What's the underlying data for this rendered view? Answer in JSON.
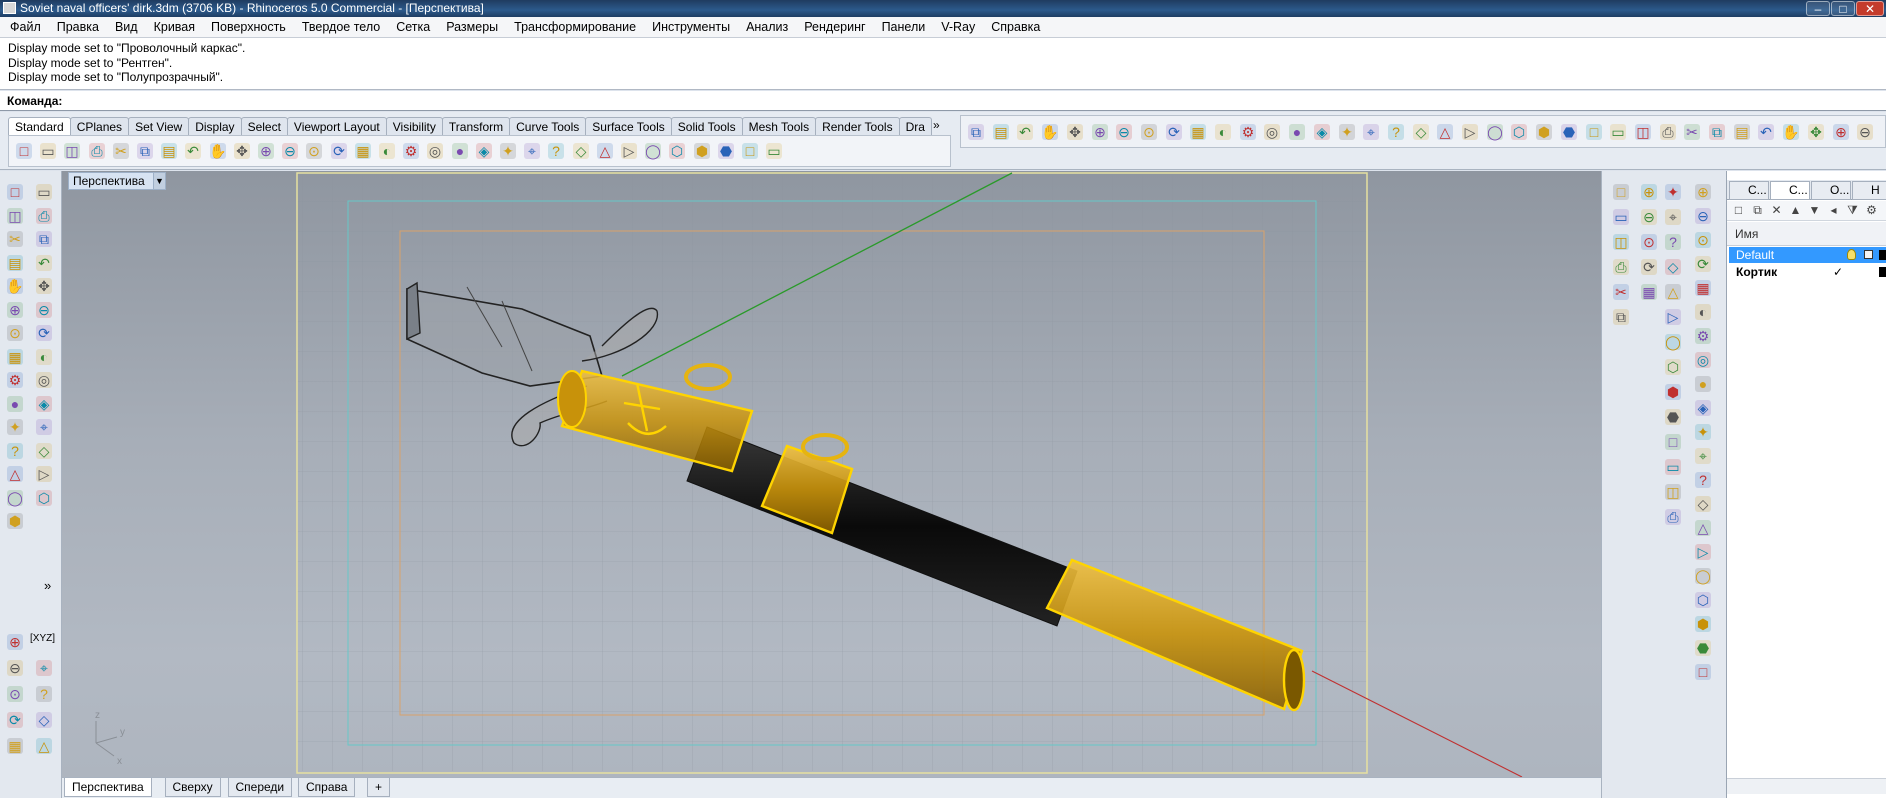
{
  "window": {
    "title": "Soviet naval officers' dirk.3dm (3706 KB) - Rhinoceros 5.0 Commercial - [Перспектива]",
    "minimize": "–",
    "maximize": "□",
    "close": "✕"
  },
  "menu": [
    "Файл",
    "Правка",
    "Вид",
    "Кривая",
    "Поверхность",
    "Твердое тело",
    "Сетка",
    "Размеры",
    "Трансформирование",
    "Инструменты",
    "Анализ",
    "Рендеринг",
    "Панели",
    "V-Ray",
    "Справка"
  ],
  "history": [
    "Display mode set to \"Проволочный каркас\".",
    "Display mode set to \"Рентген\".",
    "Display mode set to \"Полупрозрачный\"."
  ],
  "command": {
    "label": "Команда:"
  },
  "toolbar_tabs": [
    "Standard",
    "CPlanes",
    "Set View",
    "Display",
    "Select",
    "Viewport Layout",
    "Visibility",
    "Transform",
    "Curve Tools",
    "Surface Tools",
    "Solid Tools",
    "Mesh Tools",
    "Render Tools",
    "Dra"
  ],
  "tabs_more": "»",
  "viewport": {
    "title": "Перспектива",
    "axis_labels": {
      "z": "z",
      "y": "y",
      "x": "x"
    }
  },
  "left_tools": {
    "xyz_label": "[XYZ]",
    "more": "»"
  },
  "bottom_tabs": [
    "Перспектива",
    "Сверху",
    "Спереди",
    "Справа"
  ],
  "add_tab": "+",
  "panel": {
    "tabs": [
      "С...",
      "С...",
      "О...",
      "Н"
    ],
    "column_header": "Имя",
    "layers": [
      {
        "name": "Default",
        "selected": true,
        "color": "#000000"
      },
      {
        "name": "Кортик",
        "current": true,
        "check": "✓",
        "color": "#000000"
      }
    ]
  },
  "colors": {
    "accent": "#3399ff",
    "gold": "#e8a800",
    "selection": "#ffd400"
  }
}
